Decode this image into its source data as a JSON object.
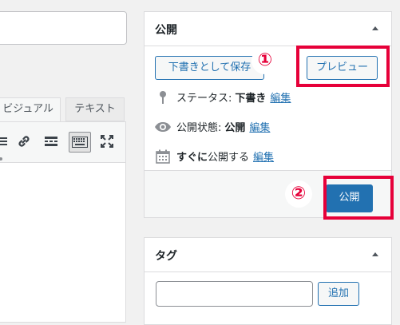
{
  "editor": {
    "tabs": {
      "visual": "ビジュアル",
      "text": "テキスト"
    },
    "toolbar_icons": [
      "list-icon",
      "link-icon",
      "read-more-icon",
      "toolbar-toggle-icon",
      "fullscreen-icon"
    ]
  },
  "publish_box": {
    "title": "公開",
    "save_draft_label": "下書きとして保存",
    "preview_label": "プレビュー",
    "status": {
      "label": "ステータス:",
      "value": "下書き",
      "edit": "編集"
    },
    "visibility": {
      "label": "公開状態:",
      "value": "公開",
      "edit": "編集"
    },
    "schedule": {
      "strong": "すぐに",
      "label": "公開する",
      "edit": "編集"
    },
    "publish_label": "公開"
  },
  "annotations": {
    "marker_1": "①",
    "marker_2": "②",
    "color": "#e60039"
  },
  "tags_box": {
    "title": "タグ",
    "add_label": "追加",
    "input_value": ""
  },
  "colors": {
    "accent": "#2271b1",
    "background": "#f1f1f1",
    "highlight": "#e60039"
  }
}
